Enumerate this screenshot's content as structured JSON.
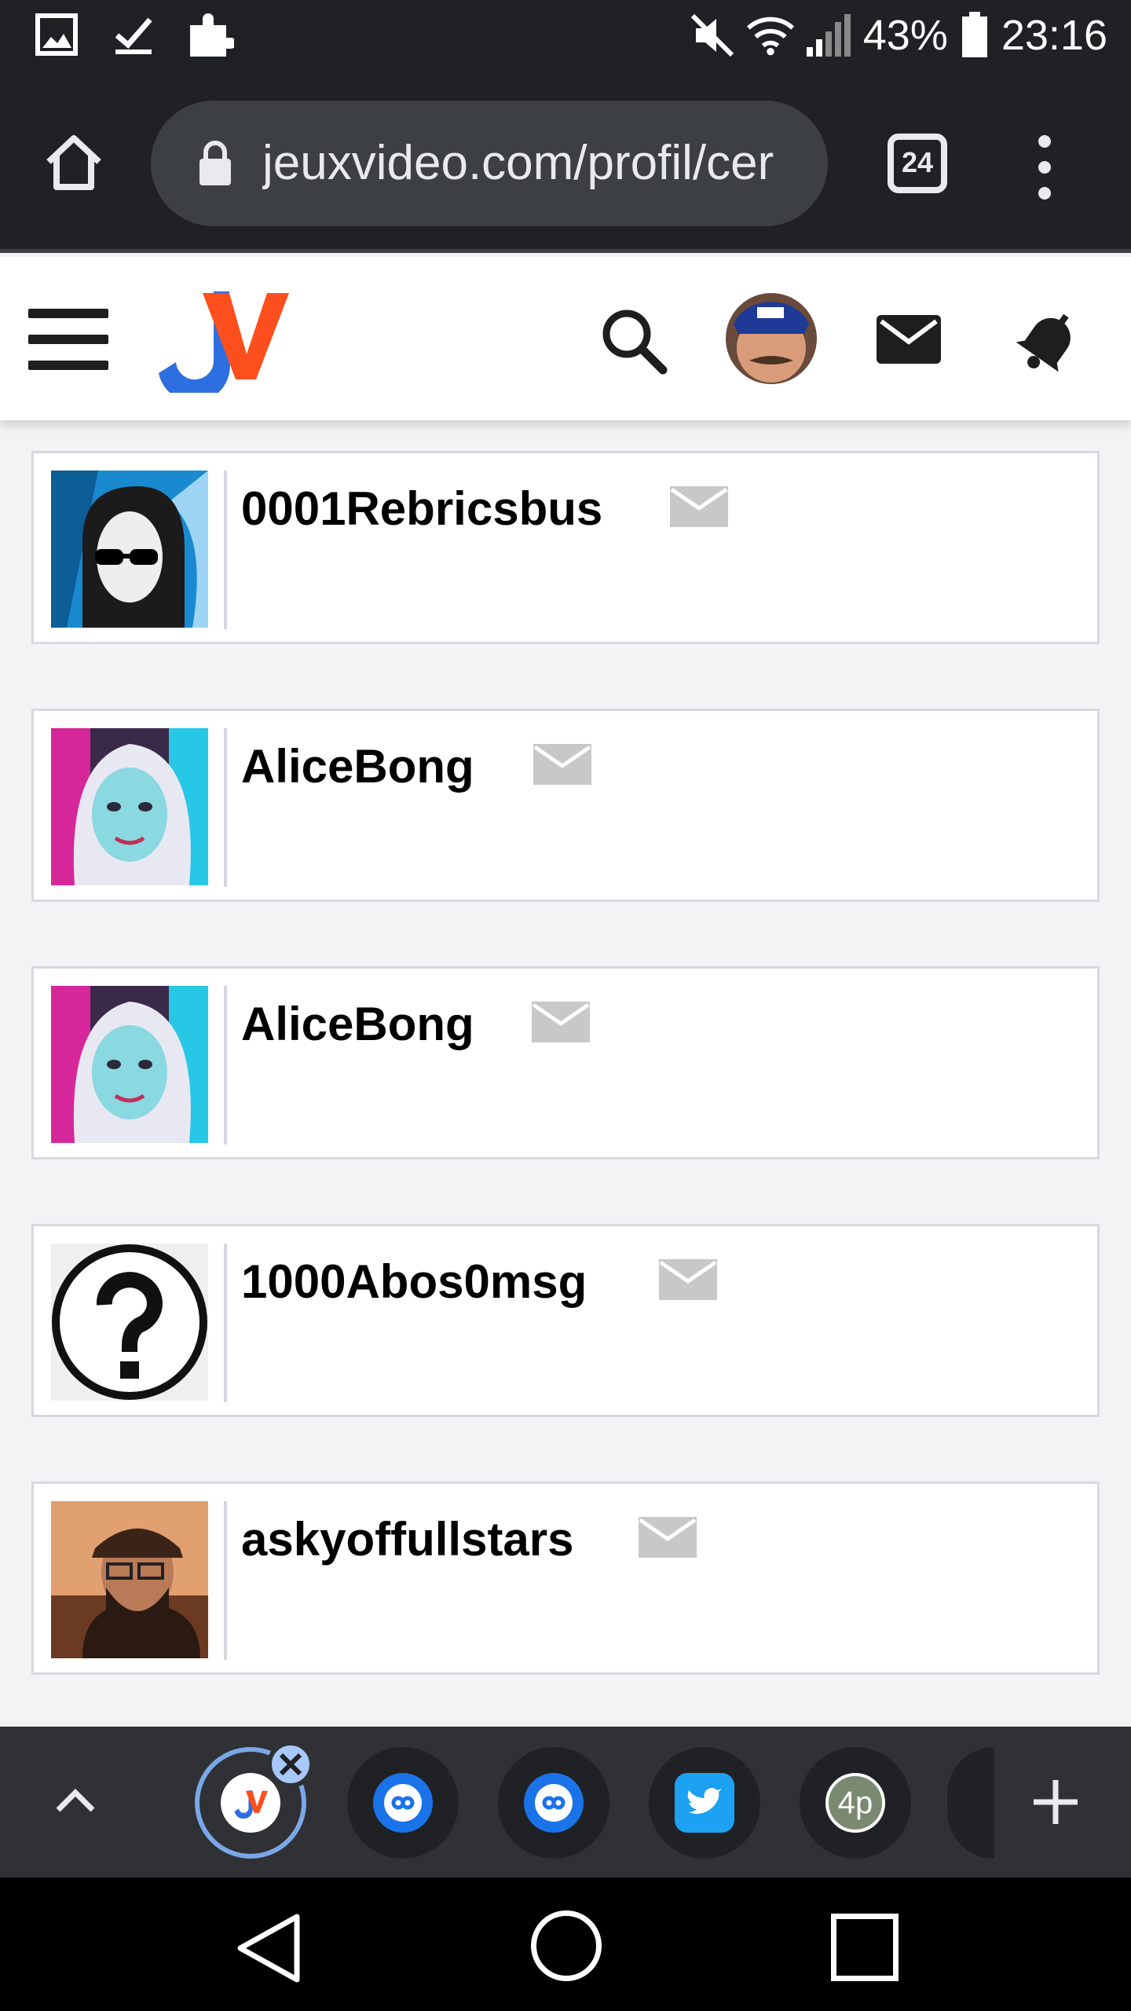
{
  "status_bar": {
    "battery": "43%",
    "time": "23:16"
  },
  "browser": {
    "url": "jeuxvideo.com/profil/cer",
    "tab_count": "24"
  },
  "site": {
    "logo_text": "JV"
  },
  "profiles": [
    {
      "username": "0001Rebricsbus",
      "avatar": "hooded-figure-avatar"
    },
    {
      "username": "AliceBong",
      "avatar": "girl-neon-avatar"
    },
    {
      "username": "AliceBong",
      "avatar": "girl-neon-avatar"
    },
    {
      "username": "1000Abos0msg",
      "avatar": "question-mark-avatar"
    },
    {
      "username": "askyoffullstars",
      "avatar": "bearded-man-avatar"
    }
  ],
  "tab_strip": {
    "tabs": [
      {
        "name": "jv-tab",
        "active": true
      },
      {
        "name": "link-tab-1"
      },
      {
        "name": "link-tab-2"
      },
      {
        "name": "twitter-tab"
      },
      {
        "name": "4p-tab",
        "label": "4p"
      }
    ]
  },
  "colors": {
    "accent_blue": "#1a73e8",
    "jv_orange": "#fd4f1d",
    "jv_blue": "#2d6fe0"
  }
}
